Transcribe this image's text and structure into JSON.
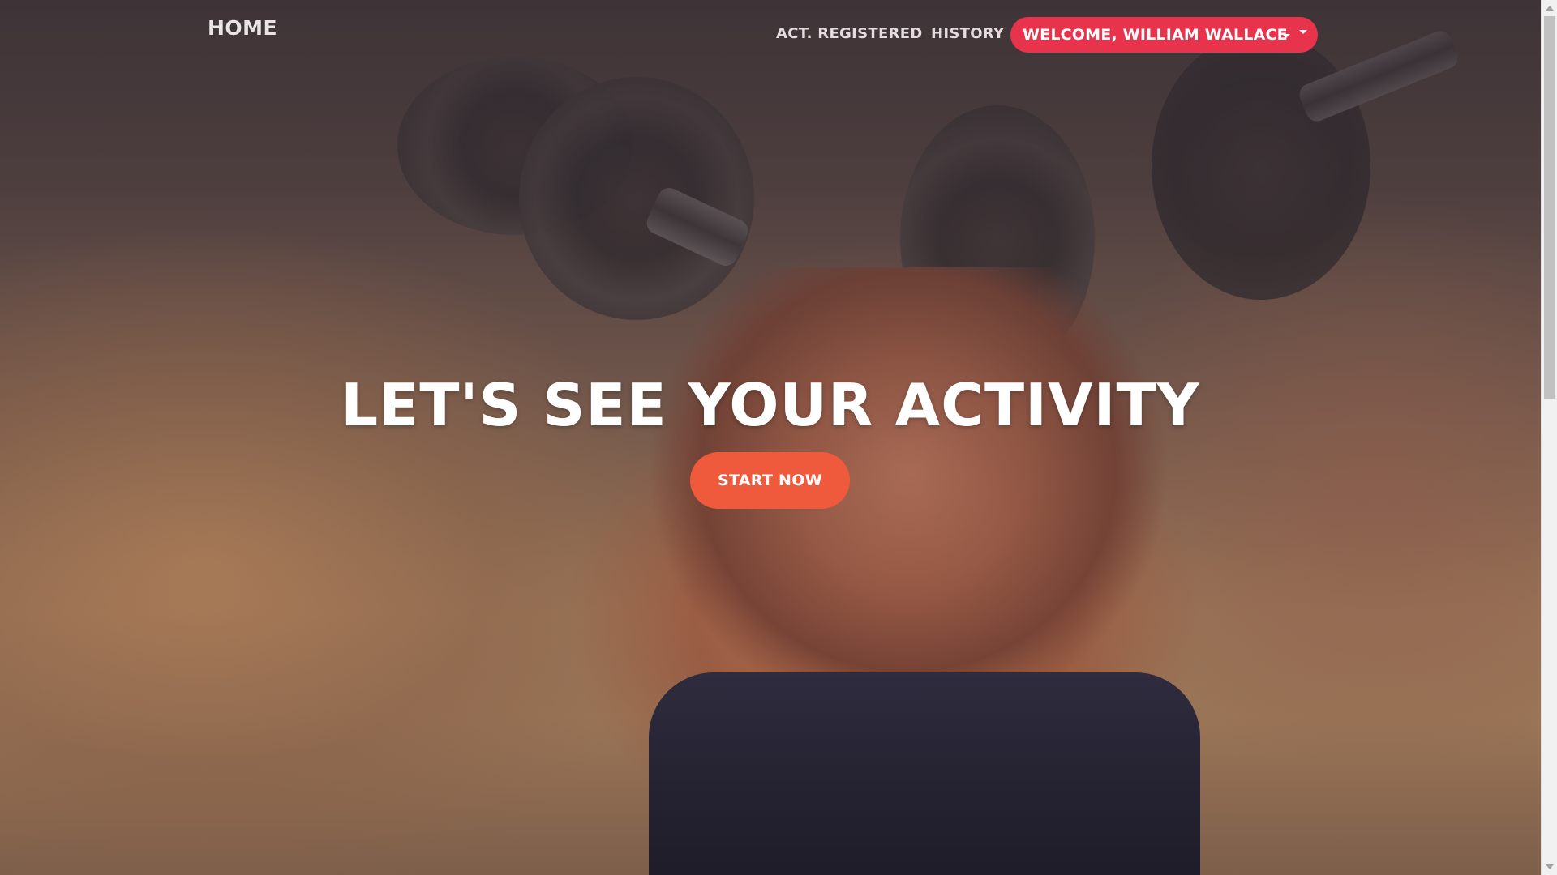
{
  "navbar": {
    "brand": "HOME",
    "links": [
      "ACT. REGISTERED",
      "HISTORY"
    ],
    "welcome_label": "WELCOME, WILLIAM WALLACE",
    "welcome_color": "#e8334c"
  },
  "hero": {
    "headline": "LET'S SEE YOUR ACTIVITY",
    "cta_label": "START NOW",
    "cta_color": "#f05a3c",
    "background_icon": "gym-photo-dumbbell-athlete"
  },
  "icons": {
    "dropdown": "chevron-down-icon",
    "scroll_up": "arrow-up-icon",
    "scroll_down": "arrow-down-icon"
  }
}
